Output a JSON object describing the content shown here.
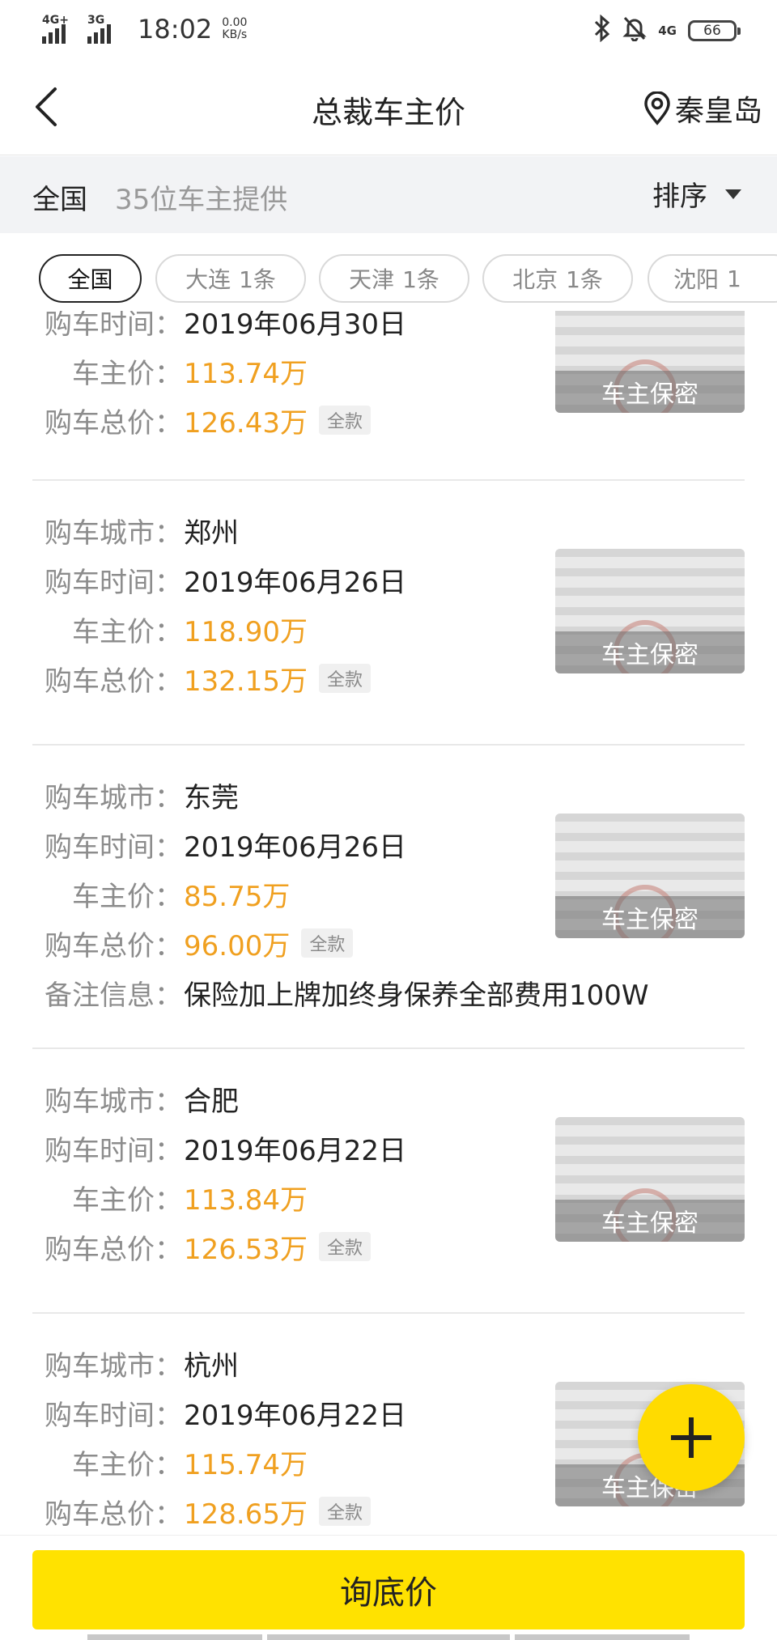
{
  "status_bar": {
    "signal1_net": "4G+",
    "signal2_net": "3G",
    "time": "18:02",
    "speed_value": "0.00",
    "speed_unit": "KB/s",
    "net_type": "4G",
    "battery": "66"
  },
  "nav": {
    "title": "总裁车主价",
    "location": "秦皇岛"
  },
  "filter": {
    "scope": "全国",
    "count_text": "35位车主提供",
    "sort_label": "排序"
  },
  "chips": [
    {
      "name": "全国",
      "count": ""
    },
    {
      "name": "大连",
      "count": "1条"
    },
    {
      "name": "天津",
      "count": "1条"
    },
    {
      "name": "北京",
      "count": "1条"
    },
    {
      "name": "沈阳",
      "count": "1"
    }
  ],
  "labels": {
    "city": "购车城市：",
    "time": "购车时间：",
    "owner_price": "车主价：",
    "total_price": "购车总价：",
    "remark": "备注信息："
  },
  "thumb_caption": "车主保密",
  "records": [
    {
      "city": "",
      "date": "2019年06月30日",
      "owner_price": "113.74万",
      "total_price": "126.43万",
      "pay": "全款",
      "remark": ""
    },
    {
      "city": "郑州",
      "date": "2019年06月26日",
      "owner_price": "118.90万",
      "total_price": "132.15万",
      "pay": "全款",
      "remark": ""
    },
    {
      "city": "东莞",
      "date": "2019年06月26日",
      "owner_price": "85.75万",
      "total_price": "96.00万",
      "pay": "全款",
      "remark": "保险加上牌加终身保养全部费用100W"
    },
    {
      "city": "合肥",
      "date": "2019年06月22日",
      "owner_price": "113.84万",
      "total_price": "126.53万",
      "pay": "全款",
      "remark": ""
    },
    {
      "city": "杭州",
      "date": "2019年06月22日",
      "owner_price": "115.74万",
      "total_price": "128.65万",
      "pay": "全款",
      "remark": ""
    }
  ],
  "bottom": {
    "ask_label": "询底价"
  },
  "colors": {
    "accent_yellow": "#ffe200",
    "price_orange": "#f0a020"
  }
}
